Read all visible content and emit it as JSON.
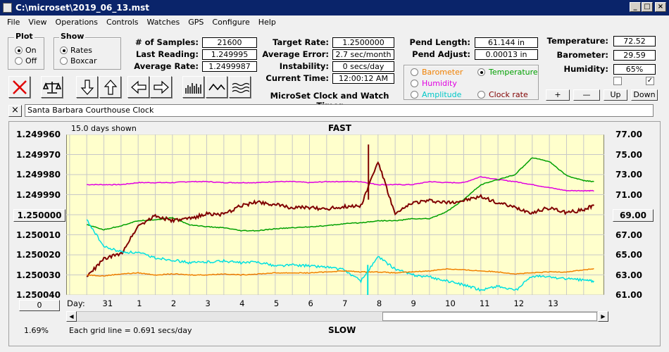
{
  "window": {
    "title": "C:\\microset\\2019_06_13.mst"
  },
  "menu": [
    "File",
    "View",
    "Operations",
    "Controls",
    "Watches",
    "GPS",
    "Configure",
    "Help"
  ],
  "plot_group": {
    "title": "Plot",
    "on": "On",
    "off": "Off",
    "selected": "On"
  },
  "show_group": {
    "title": "Show",
    "rates": "Rates",
    "boxcar": "Boxcar",
    "selected": "Rates"
  },
  "stats": {
    "samples_label": "# of Samples:",
    "samples": "21600",
    "last_label": "Last Reading:",
    "last": "1.249995",
    "avg_label": "Average Rate:",
    "avg": "1.2499987",
    "target_label": "Target Rate:",
    "target": "1.2500000",
    "err_label": "Average Error:",
    "err": "2.7 sec/month",
    "instab_label": "Instability:",
    "instab": "0 secs/day",
    "time_label": "Current Time:",
    "time": "12:00:12 AM",
    "pend_len_label": "Pend Length:",
    "pend_len": "61.144 in",
    "pend_adj_label": "Pend Adjust:",
    "pend_adj": "0.00013 in",
    "temp_label": "Temperature:",
    "temp": "72.52",
    "baro_label": "Barometer:",
    "baro": "29.59",
    "hum_label": "Humidity:",
    "hum": "65%"
  },
  "app_caption": "MicroSet Clock and Watch Timer",
  "sensors": {
    "barometer": "Barometer",
    "temperature": "Temperature",
    "humidity": "Humidity",
    "amplitude": "Amplitude",
    "clock_rate": "Clock rate",
    "selected": "Temperature"
  },
  "colors": {
    "barometer": "#f08000",
    "temperature": "#00a000",
    "humidity": "#e000e0",
    "amplitude": "#00e0e0",
    "clock_rate": "#800000",
    "plot_bg": "#ffffcc"
  },
  "adjust_buttons": {
    "plus": "+",
    "minus": "—",
    "up": "Up",
    "down": "Down"
  },
  "checkboxes": [
    false,
    true
  ],
  "clock_name": "Santa Barbara Courthouse Clock",
  "close_x": "×",
  "chart_header": {
    "days_shown": "15.0 days shown",
    "fast": "FAST",
    "slow": "SLOW",
    "grid_note": "Each grid line = 0.691 secs/day",
    "percent": "1.69%",
    "day_label": "Day:",
    "center_left": "1.250000",
    "center_right": "69.00",
    "zero_btn": "0"
  },
  "chart_data": {
    "type": "line",
    "title": "",
    "y_left_ticks": [
      "1.249960",
      "1.249970",
      "1.249980",
      "1.249990",
      "1.250000",
      "1.250010",
      "1.250020",
      "1.250030",
      "1.250040"
    ],
    "y_right_ticks": [
      "77.00",
      "75.00",
      "73.00",
      "71.00",
      "69.00",
      "67.00",
      "65.00",
      "63.00",
      "61.00"
    ],
    "x_ticks": [
      "31",
      "1",
      "2",
      "3",
      "4",
      "5",
      "6",
      "7",
      "8",
      "9",
      "10",
      "11",
      "12",
      "13"
    ],
    "x": [
      -0.5,
      0.0,
      0.5,
      1.0,
      1.5,
      2.0,
      2.5,
      3.0,
      3.5,
      4.0,
      4.5,
      5.0,
      5.5,
      6.0,
      6.5,
      7.0,
      7.5,
      8.0,
      8.5,
      9.0,
      9.5,
      10.0,
      10.5,
      11.0,
      11.5,
      12.0,
      12.5,
      13.0,
      13.5,
      14.0,
      14.3
    ],
    "series": [
      {
        "name": "Humidity",
        "color": "#e000e0",
        "values": [
          72.0,
          72.0,
          72.0,
          72.2,
          72.2,
          72.2,
          72.3,
          72.3,
          72.2,
          72.2,
          72.2,
          72.3,
          72.3,
          72.2,
          72.3,
          72.3,
          72.3,
          72.0,
          72.0,
          72.0,
          72.3,
          72.2,
          72.2,
          72.8,
          72.5,
          72.3,
          72.0,
          71.7,
          71.4,
          71.4,
          71.4
        ]
      },
      {
        "name": "Temperature",
        "color": "#00a000",
        "values": [
          68.0,
          67.5,
          67.9,
          68.4,
          68.5,
          68.7,
          68.0,
          67.8,
          67.7,
          67.4,
          67.4,
          67.6,
          67.7,
          67.8,
          67.9,
          68.1,
          68.2,
          68.4,
          68.4,
          68.6,
          68.6,
          69.3,
          70.5,
          72.0,
          72.5,
          73.0,
          74.7,
          74.3,
          72.9,
          72.4,
          72.3
        ]
      },
      {
        "name": "Clock rate",
        "color": "#800000",
        "values": [
          62.8,
          64.6,
          65.1,
          67.9,
          68.9,
          68.4,
          68.6,
          69.1,
          69.0,
          69.9,
          70.3,
          70.0,
          69.7,
          69.7,
          69.6,
          69.8,
          69.9,
          74.3,
          69.0,
          70.2,
          70.4,
          70.2,
          70.4,
          70.8,
          70.2,
          69.7,
          69.2,
          69.7,
          69.2,
          69.5,
          70.0
        ]
      },
      {
        "name": "Amplitude",
        "color": "#00e0e0",
        "values": [
          68.5,
          65.8,
          65.3,
          65.2,
          64.7,
          64.5,
          64.2,
          64.3,
          64.4,
          64.2,
          64.3,
          63.9,
          64.0,
          63.9,
          63.8,
          63.5,
          62.4,
          64.8,
          63.6,
          63.0,
          62.8,
          62.4,
          62.0,
          61.5,
          61.9,
          61.4,
          62.9,
          62.8,
          62.6,
          62.5,
          62.4
        ]
      },
      {
        "name": "Barometer",
        "color": "#f08000",
        "values": [
          63.0,
          62.9,
          63.1,
          63.2,
          63.0,
          63.1,
          63.0,
          63.0,
          63.1,
          63.0,
          63.1,
          63.2,
          63.2,
          63.2,
          63.3,
          63.4,
          63.3,
          63.3,
          63.2,
          63.3,
          63.4,
          63.6,
          63.5,
          63.4,
          63.3,
          63.1,
          63.2,
          63.3,
          63.3,
          63.5,
          63.6
        ]
      }
    ]
  }
}
